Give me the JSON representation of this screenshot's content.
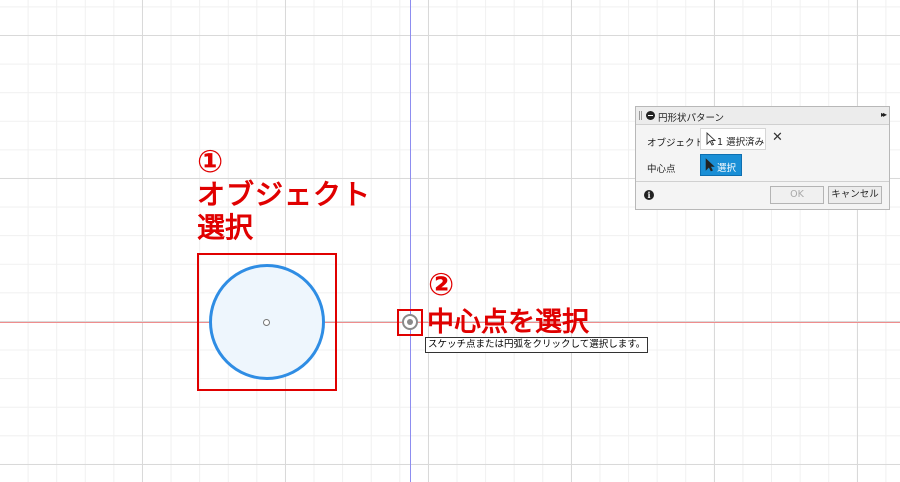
{
  "dialog": {
    "title": "円形状パターン",
    "object_label": "オブジェクト",
    "object_value": "1 選択済み",
    "center_label": "中心点",
    "center_value": "選択",
    "ok_label": "OK",
    "cancel_label": "キャンセル",
    "info_glyph": "i",
    "clear_glyph": "✕",
    "expand_glyph": "▸▸"
  },
  "annotations": {
    "step1_number": "①",
    "step1_line1": "オブジェクト",
    "step1_line2": "選択",
    "step2_number": "②",
    "step2_text": "中心点を選択"
  },
  "tooltip": "スケッチ点または円弧をクリックして選択します。",
  "colors": {
    "annotation_red": "#e00000",
    "accent_blue": "#1a8fd6",
    "sketch_blue": "#2f8de4",
    "x_axis": "#ef8d8d",
    "y_axis": "#8d8df0"
  },
  "icons": {
    "header_collapse": "minus-circle-icon",
    "object_select": "arrow-cursor-icon",
    "center_select": "arrow-cursor-icon",
    "clear": "close-icon",
    "footer_info": "info-icon",
    "origin": "origin-point-icon"
  }
}
